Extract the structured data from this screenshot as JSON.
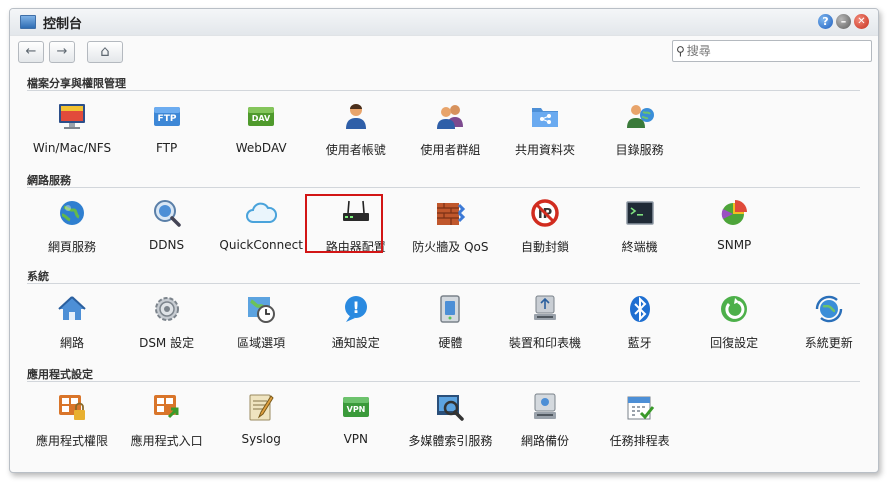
{
  "window": {
    "title": "控制台"
  },
  "toolbar": {
    "back": "←",
    "forward": "→",
    "home": "⌂"
  },
  "search": {
    "placeholder": "搜尋",
    "value": ""
  },
  "sections": [
    {
      "title": "檔案分享與權限管理",
      "items": [
        {
          "label": "Win/Mac/NFS",
          "icon": "win-mac-nfs-icon"
        },
        {
          "label": "FTP",
          "icon": "ftp-icon"
        },
        {
          "label": "WebDAV",
          "icon": "webdav-icon"
        },
        {
          "label": "使用者帳號",
          "icon": "user-icon"
        },
        {
          "label": "使用者群組",
          "icon": "group-icon"
        },
        {
          "label": "共用資料夾",
          "icon": "shared-folder-icon"
        },
        {
          "label": "目錄服務",
          "icon": "directory-service-icon"
        }
      ]
    },
    {
      "title": "網路服務",
      "items": [
        {
          "label": "網頁服務",
          "icon": "globe-icon"
        },
        {
          "label": "DDNS",
          "icon": "ddns-icon"
        },
        {
          "label": "QuickConnect",
          "icon": "cloud-icon"
        },
        {
          "label": "路由器配置",
          "icon": "router-icon"
        },
        {
          "label": "防火牆及 QoS",
          "icon": "firewall-icon"
        },
        {
          "label": "自動封鎖",
          "icon": "block-icon"
        },
        {
          "label": "終端機",
          "icon": "terminal-icon"
        },
        {
          "label": "SNMP",
          "icon": "pie-chart-icon"
        }
      ]
    },
    {
      "title": "系統",
      "items": [
        {
          "label": "網路",
          "icon": "home-network-icon"
        },
        {
          "label": "DSM 設定",
          "icon": "gear-icon"
        },
        {
          "label": "區域選項",
          "icon": "clock-map-icon"
        },
        {
          "label": "通知設定",
          "icon": "notification-icon"
        },
        {
          "label": "硬體",
          "icon": "hardware-icon"
        },
        {
          "label": "裝置和印表機",
          "icon": "usb-icon"
        },
        {
          "label": "藍牙",
          "icon": "bluetooth-icon"
        },
        {
          "label": "回復設定",
          "icon": "restore-icon"
        },
        {
          "label": "系統更新",
          "icon": "update-icon"
        }
      ]
    },
    {
      "title": "應用程式設定",
      "items": [
        {
          "label": "應用程式權限",
          "icon": "app-lock-icon"
        },
        {
          "label": "應用程式入口",
          "icon": "app-portal-icon"
        },
        {
          "label": "Syslog",
          "icon": "syslog-icon"
        },
        {
          "label": "VPN",
          "icon": "vpn-icon"
        },
        {
          "label": "多媒體索引服務",
          "icon": "media-index-icon"
        },
        {
          "label": "網路備份",
          "icon": "network-backup-icon"
        },
        {
          "label": "任務排程表",
          "icon": "task-scheduler-icon"
        }
      ]
    }
  ],
  "highlight": {
    "section": 1,
    "item": 3
  }
}
